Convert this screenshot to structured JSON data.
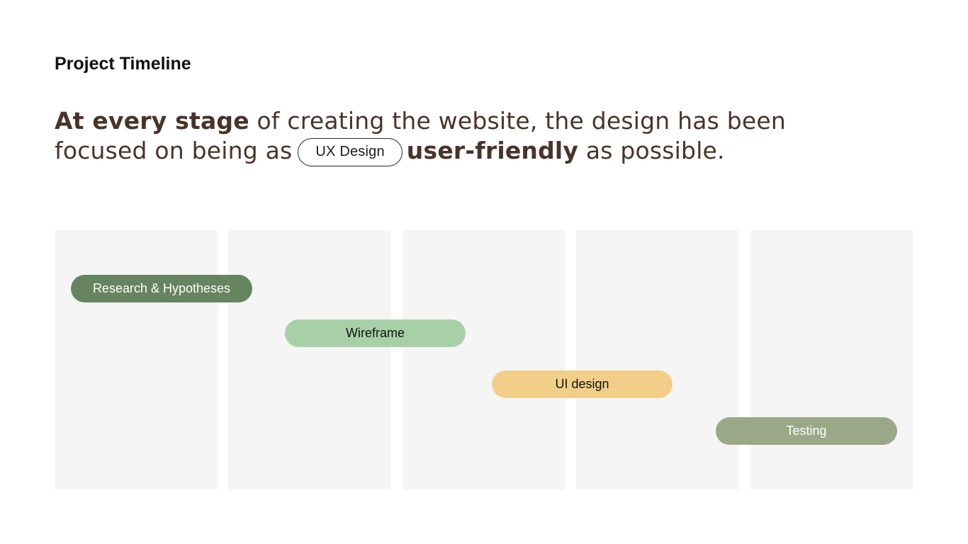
{
  "title": "Project Timeline",
  "headline": {
    "part1_bold": "At every stage",
    "part1_rest": " of creating the website, the design has been",
    "part2_start": "focused on being as",
    "tag": "UX Design",
    "part2_bold": "user-friendly",
    "part2_end": " as possible."
  },
  "timeline": {
    "column_count": 5,
    "tasks": [
      {
        "label": "Research & Hypotheses",
        "color": "#66845f",
        "text_color": "#ffffff"
      },
      {
        "label": "Wireframe",
        "color": "#a8d0a8",
        "text_color": "#111111"
      },
      {
        "label": "UI design",
        "color": "#f1cf88",
        "text_color": "#111111"
      },
      {
        "label": "Testing",
        "color": "#9aa887",
        "text_color": "#ffffff"
      }
    ]
  },
  "colors": {
    "column_bg": "#f5f5f5",
    "headline_text": "#4a3328"
  }
}
